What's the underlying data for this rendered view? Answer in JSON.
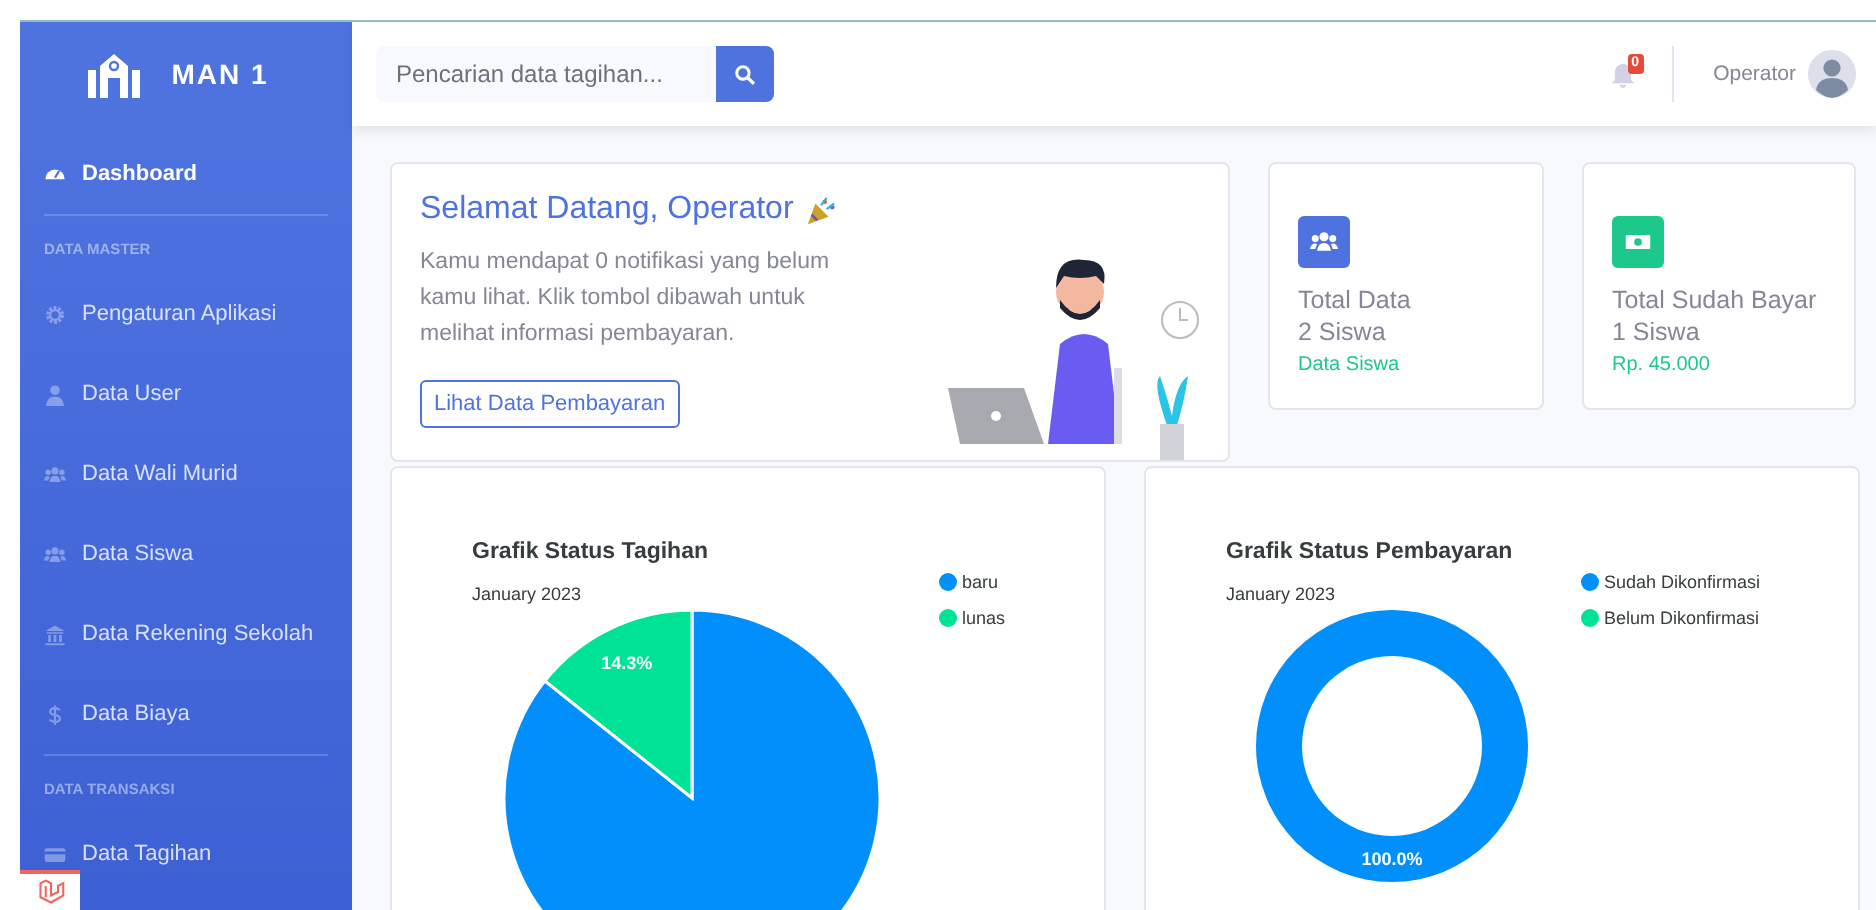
{
  "brand": {
    "name": "MAN 1"
  },
  "sidebar": {
    "items": [
      {
        "kind": "link",
        "label": "Dashboard",
        "selected": true
      },
      {
        "kind": "heading",
        "label": "DATA MASTER"
      },
      {
        "kind": "link",
        "label": "Pengaturan Aplikasi",
        "selected": false
      },
      {
        "kind": "link",
        "label": "Data User",
        "selected": false
      },
      {
        "kind": "link",
        "label": "Data Wali Murid",
        "selected": false
      },
      {
        "kind": "link",
        "label": "Data Siswa",
        "selected": false
      },
      {
        "kind": "link",
        "label": "Data Rekening Sekolah",
        "selected": false
      },
      {
        "kind": "link",
        "label": "Data Biaya",
        "selected": false
      },
      {
        "kind": "heading",
        "label": "DATA TRANSAKSI"
      },
      {
        "kind": "link",
        "label": "Data Tagihan",
        "selected": false
      }
    ]
  },
  "topbar": {
    "search": {
      "placeholder": "Pencarian data tagihan..."
    },
    "notifications": {
      "count": "0"
    },
    "user": {
      "name": "Operator"
    }
  },
  "welcome": {
    "title": "Selamat Datang, Operator",
    "text": "Kamu mendapat 0 notifikasi yang belum kamu lihat. Klik tombol dibawah untuk melihat informasi pembayaran.",
    "button": "Lihat Data Pembayaran"
  },
  "stats": [
    {
      "title": "Total Data",
      "value": "2 Siswa",
      "link": "Data Siswa",
      "color": "#4e73df"
    },
    {
      "title": "Total Sudah Bayar",
      "value": "1 Siswa",
      "link": "Rp. 45.000",
      "color": "#1cc88a"
    }
  ],
  "charts": [
    {
      "subtitle": "January 2023",
      "chart_data": {
        "type": "pie",
        "title": "Grafik Status Tagihan",
        "categories": [
          "baru",
          "lunas"
        ],
        "values": [
          85.7,
          14.3
        ],
        "value_labels": [
          null,
          "14.3%"
        ],
        "legend": "right"
      }
    },
    {
      "subtitle": "January 2023",
      "chart_data": {
        "type": "donut",
        "title": "Grafik Status Pembayaran",
        "categories": [
          "Sudah Dikonfirmasi",
          "Belum Dikonfirmasi"
        ],
        "values": [
          100,
          0
        ],
        "value_labels": [
          "100.0%",
          null
        ],
        "legend": "right"
      }
    }
  ]
}
